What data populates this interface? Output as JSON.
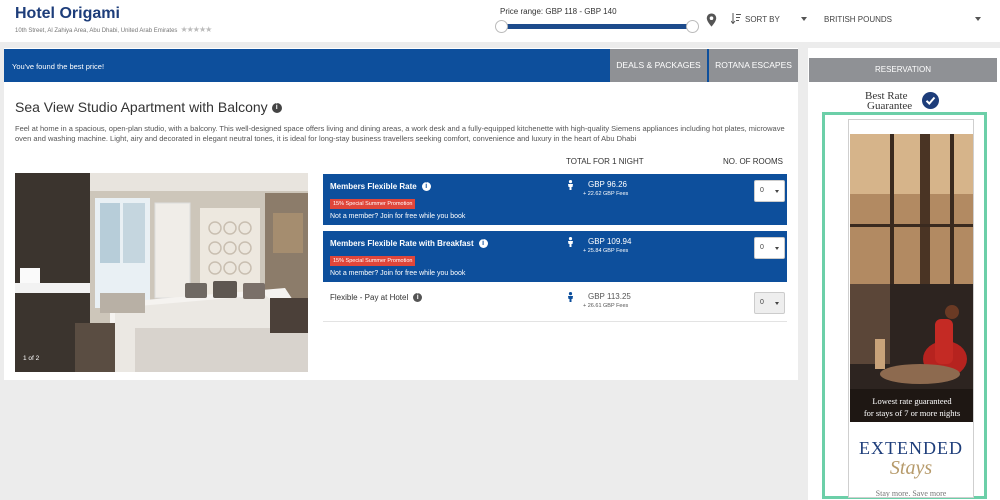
{
  "header": {
    "hotel_name": "Hotel Origami",
    "address": "10th Street, Al Zahiya Area, Abu Dhabi, United Arab Emirates",
    "stars": "★★★★★",
    "price_range_label": "Price range:",
    "price_range_value": "GBP 118 - GBP 140",
    "sort_label": "SORT BY",
    "currency": "BRITISH POUNDS"
  },
  "banner": {
    "message": "You've found the best price!",
    "tabs": [
      {
        "label": "DEALS & PACKAGES"
      },
      {
        "label": "ROTANA ESCAPES"
      }
    ]
  },
  "room": {
    "title": "Sea View Studio Apartment with Balcony",
    "description": "Feel at home in a spacious, open-plan studio, with a balcony. This well-designed space offers living and dining areas, a work desk and a fully-equipped kitchenette with high-quality Siemens appliances including hot plates, microwave oven and washing machine. Light, airy and decorated in elegant neutral tones, it is ideal for long-stay business travellers seeking comfort, convenience and luxury in the heart of Abu Dhabi",
    "photo_counter": "1 of 2",
    "col_total": "TOTAL FOR 1 NIGHT",
    "col_rooms": "NO. OF ROOMS"
  },
  "rates": [
    {
      "name": "Members Flexible Rate",
      "promo": "15% Special Summer Promotion",
      "join": "Not a member? Join for free while you book",
      "price": "GBP 96.26",
      "fees": "+ 22.62 GBP Fees",
      "rooms": "0"
    },
    {
      "name": "Members Flexible Rate with Breakfast",
      "promo": "15% Special Summer Promotion",
      "join": "Not a member? Join for free while you book",
      "price": "GBP 109.94",
      "fees": "+ 25.84 GBP Fees",
      "rooms": "0"
    },
    {
      "name": "Flexible - Pay at Hotel",
      "price": "GBP 113.25",
      "fees": "+ 26.61 GBP Fees",
      "rooms": "0"
    }
  ],
  "reservation": {
    "header": "RESERVATION",
    "best_rate_line1": "Best Rate",
    "best_rate_line2": "Guarantee"
  },
  "ad": {
    "caption_line1": "Lowest rate guaranteed",
    "caption_line2": "for stays of 7 or more nights",
    "extended": "EXTENDED",
    "stays": "Stays",
    "tagline": "Stay more. Save more"
  },
  "colors": {
    "brand_blue": "#0d4f9c",
    "promo_red": "#e0463a",
    "tab_gray": "#8f9195",
    "ad_border": "#6ccfa8"
  }
}
